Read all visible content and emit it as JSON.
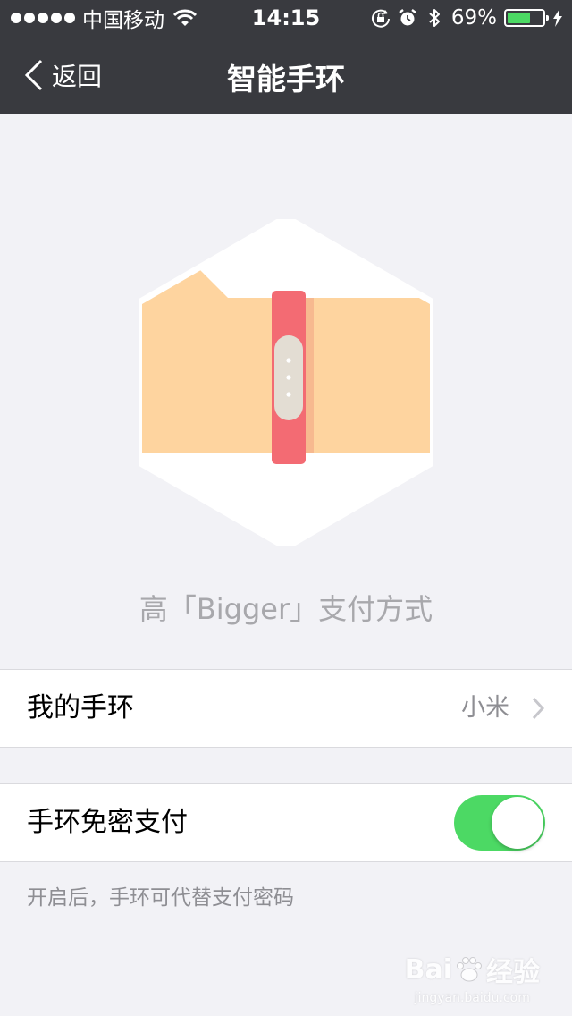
{
  "status_bar": {
    "carrier": "中国移动",
    "time": "14:15",
    "battery_percent_text": "69%",
    "battery_level": 0.69
  },
  "nav": {
    "back_label": "返回",
    "title": "智能手环"
  },
  "hero": {
    "slogan": "高「Bigger」支付方式"
  },
  "cells": {
    "my_band": {
      "label": "我的手环",
      "value": "小米"
    },
    "password_free": {
      "label": "手环免密支付",
      "enabled": true
    }
  },
  "note": "开启后，手环可代替支付密码",
  "watermark": {
    "logo_text_left": "Bai",
    "logo_text_right": "经验",
    "url": "jingyan.baidu.com"
  },
  "colors": {
    "nav_background": "#393a3f",
    "page_background": "#f2f2f6",
    "accent_green": "#4cd964",
    "band_red": "#f36b73",
    "wallet_orange": "#fed49f"
  }
}
